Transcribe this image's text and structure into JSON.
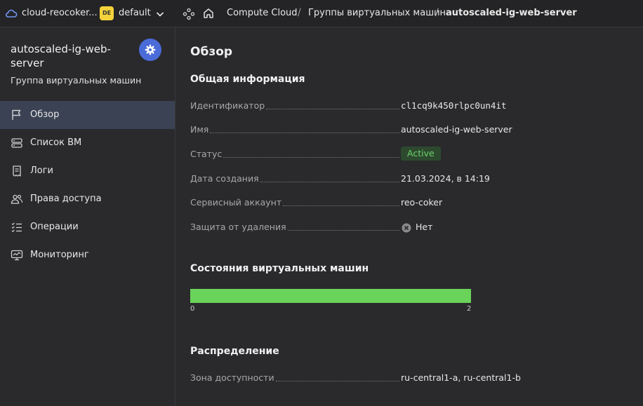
{
  "header": {
    "cloud_name": "cloud-reocoker...",
    "folder_badge": "DE",
    "folder_name": "default",
    "breadcrumbs": [
      "Compute Cloud",
      "Группы виртуальных машин",
      "autoscaled-ig-web-server"
    ],
    "separator": "/",
    "colors": {
      "badge": "#f4d23b",
      "accent": "#4a6bd8"
    }
  },
  "sidebar": {
    "title": "autoscaled-ig-web-server",
    "subtitle": "Группа виртуальных машин",
    "settings_icon": "gear-icon",
    "items": [
      {
        "label": "Обзор",
        "icon": "flag-icon",
        "active": true
      },
      {
        "label": "Список ВМ",
        "icon": "vm-list-icon",
        "active": false
      },
      {
        "label": "Логи",
        "icon": "logs-icon",
        "active": false
      },
      {
        "label": "Права доступа",
        "icon": "users-icon",
        "active": false
      },
      {
        "label": "Операции",
        "icon": "operations-icon",
        "active": false
      },
      {
        "label": "Мониторинг",
        "icon": "monitoring-icon",
        "active": false
      }
    ]
  },
  "main": {
    "page_title": "Обзор",
    "general": {
      "title": "Общая информация",
      "id_label": "Идентификатор",
      "id_value": "cl1cq9k450rlpc0un4it",
      "name_label": "Имя",
      "name_value": "autoscaled-ig-web-server",
      "status_label": "Статус",
      "status_value": "Active",
      "created_label": "Дата создания",
      "created_value": "21.03.2024, в 14:19",
      "sa_label": "Сервисный аккаунт",
      "sa_value": "reo-coker",
      "protection_label": "Защита от удаления",
      "protection_value": "Нет"
    },
    "vm_states": {
      "title": "Состояния виртуальных машин",
      "bar_min": "0",
      "bar_max": "2",
      "running_count": 2,
      "total": 2
    },
    "distribution": {
      "title": "Распределение",
      "zone_label": "Зона доступности",
      "zone_value": "ru-central1-a, ru-central1-b"
    }
  }
}
